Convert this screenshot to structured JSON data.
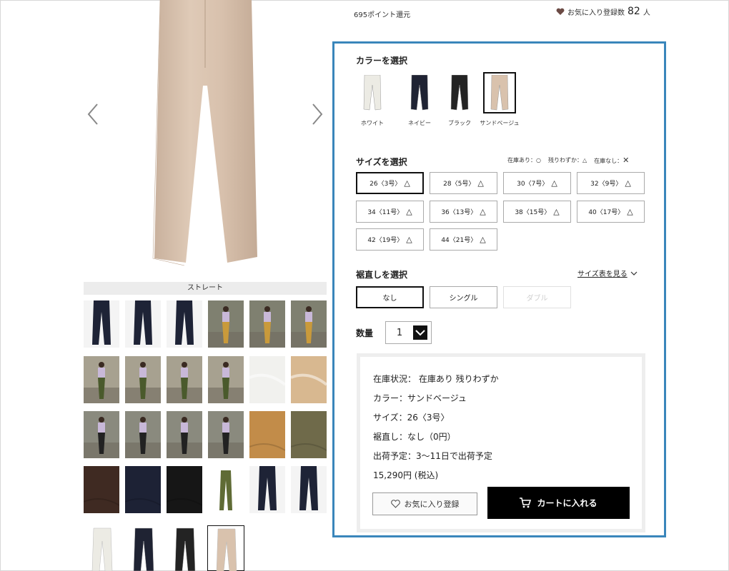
{
  "header": {
    "points": "695ポイント還元",
    "favorite_label": "お気に入り登録数",
    "favorite_count": "82",
    "favorite_unit": "人"
  },
  "gallery": {
    "caption": "ストレート",
    "model_thumbs": 16,
    "fabric_thumbs": 6,
    "detail_thumbs": 5
  },
  "panel": {
    "color_title": "カラーを選択",
    "colors": [
      {
        "label": "ホワイト",
        "hex": "#ecebe4"
      },
      {
        "label": "ネイビー",
        "hex": "#1f2333"
      },
      {
        "label": "ブラック",
        "hex": "#232323"
      },
      {
        "label": "サンドベージュ",
        "hex": "#d9c2ad"
      }
    ],
    "selected_color_index": 3,
    "size_title": "サイズを選択",
    "legend": {
      "in_stock": "在庫あり：○",
      "few_left": "残りわずか：△",
      "out_of_stock": "在庫なし：",
      "out_symbol": "✕"
    },
    "sizes": [
      {
        "label": "26〈3号〉",
        "status": "△"
      },
      {
        "label": "28〈5号〉",
        "status": "△"
      },
      {
        "label": "30〈7号〉",
        "status": "△"
      },
      {
        "label": "32〈9号〉",
        "status": "△"
      },
      {
        "label": "34〈11号〉",
        "status": "△"
      },
      {
        "label": "36〈13号〉",
        "status": "△"
      },
      {
        "label": "38〈15号〉",
        "status": "△"
      },
      {
        "label": "40〈17号〉",
        "status": "△"
      },
      {
        "label": "42〈19号〉",
        "status": "△"
      },
      {
        "label": "44〈21号〉",
        "status": "△"
      }
    ],
    "hem_title": "裾直しを選択",
    "size_chart_link": "サイズ表を見る",
    "hem_options": [
      {
        "label": "なし",
        "state": "selected"
      },
      {
        "label": "シングル",
        "state": "default"
      },
      {
        "label": "ダブル",
        "state": "disabled"
      }
    ],
    "qty_label": "数量",
    "qty_value": "1",
    "summary": {
      "stock": "在庫状況： 在庫あり 残りわずか",
      "color": "カラー：サンドベージュ",
      "size": "サイズ：26〈3号〉",
      "hem": "裾直し：なし（0円）",
      "ship": "出荷予定：3〜11日で出荷予定",
      "price": "15,290円 (税込)"
    },
    "fav_button": "お気に入り登録",
    "cart_button": "カートに入れる"
  },
  "colors": {
    "accent_border": "#3a86bb",
    "cart_bg": "#000000",
    "sand": "#d9c2ad"
  }
}
